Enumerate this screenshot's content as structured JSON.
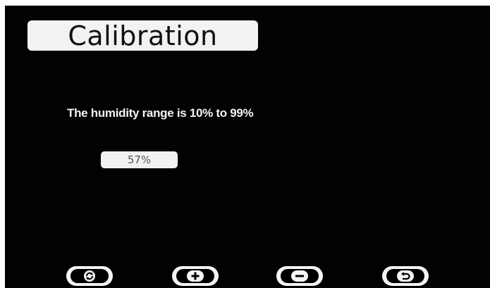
{
  "header": {
    "title": "Calibration"
  },
  "main": {
    "range_text": "The humidity range is 10% to 99%",
    "humidity_value": "57%"
  },
  "softkeys": [
    {
      "icon": "refresh-icon"
    },
    {
      "icon": "plus-icon"
    },
    {
      "icon": "minus-icon"
    },
    {
      "icon": "back-icon"
    }
  ],
  "colors": {
    "background": "#020202",
    "panel": "#f2f2f2",
    "text_light": "#f4f4f4"
  }
}
